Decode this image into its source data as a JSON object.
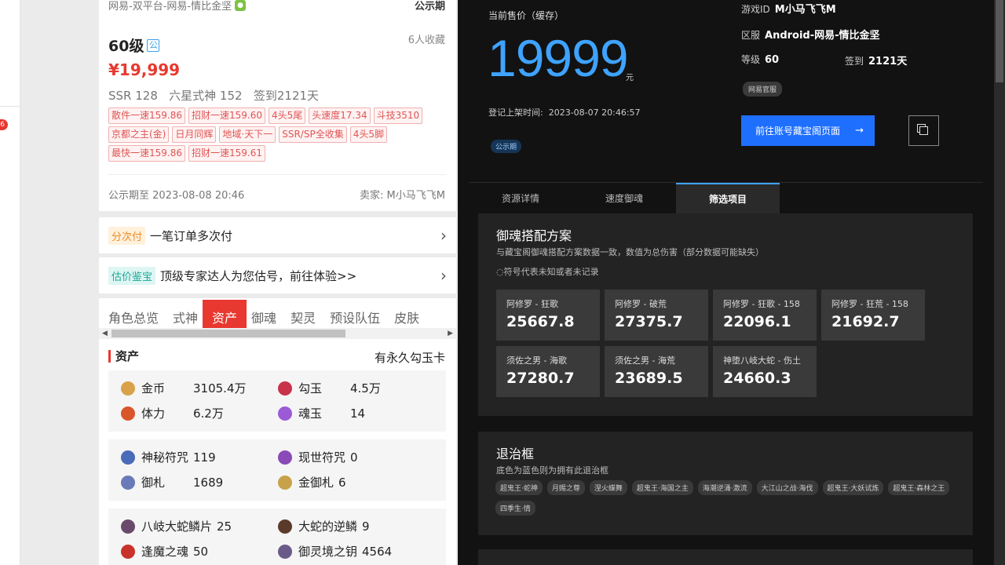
{
  "left": {
    "source": "网易-双平台-网易-情比金坚",
    "stage": "公示期",
    "level": "60级",
    "gong": "公",
    "favorites": "6人收藏",
    "price": "¥19,999",
    "stats": "SSR 128   六星式神 152   签到2121天",
    "tags": [
      "散件一速159.86",
      "招财一速159.60",
      "4头5尾",
      "头速度17.34",
      "斗技3510",
      "京都之主(金)",
      "日月同辉",
      "地域·天下一",
      "SSR/SP全收集",
      "4头5脚",
      "最快一速159.86",
      "招财一速159.61"
    ],
    "pubdate": "公示期至 2023-08-08 20:46",
    "seller": "卖家: M小马飞飞M",
    "promo1": {
      "badge": "分次付",
      "text": "一笔订单多次付"
    },
    "promo2": {
      "badge": "估价鉴宝",
      "text": "顶级专家达人为您估号，前往体验>>"
    },
    "tabs": [
      "角色总览",
      "式神",
      "资产",
      "御魂",
      "契灵",
      "预设队伍",
      "皮肤"
    ],
    "assets_title": "资产",
    "assets_right": "有永久勾玉卡",
    "assets_box1": [
      {
        "name": "金币",
        "value": "3105.4万",
        "color": "#d9a24a"
      },
      {
        "name": "勾玉",
        "value": "4.5万",
        "color": "#c8324a"
      },
      {
        "name": "体力",
        "value": "6.2万",
        "color": "#d9562a"
      },
      {
        "name": "魂玉",
        "value": "14",
        "color": "#9b5bd6"
      }
    ],
    "assets_box2": [
      {
        "name": "神秘符咒",
        "value": "119",
        "color": "#4a6bb8"
      },
      {
        "name": "现世符咒",
        "value": "0",
        "color": "#8a4ab8"
      },
      {
        "name": "御札",
        "value": "1689",
        "color": "#6a7ab8"
      },
      {
        "name": "金御札",
        "value": "6",
        "color": "#c8a24a"
      }
    ],
    "assets_box3": [
      {
        "name": "八岐大蛇鳞片",
        "value": "25",
        "color": "#6a4a6a"
      },
      {
        "name": "大蛇的逆鳞",
        "value": "9",
        "color": "#5a3a2a"
      },
      {
        "name": "逢魔之魂",
        "value": "50",
        "color": "#c8322a"
      },
      {
        "name": "御灵境之钥",
        "value": "4564",
        "color": "#6a5a8a"
      }
    ]
  },
  "right": {
    "price_label": "当前售价（缓存）",
    "price": "19999",
    "yuan": "元",
    "list_time_label": "登记上架时间:",
    "list_time": "2023-08-07 20:46:57",
    "stage_pill": "公示期",
    "game_id_label": "游戏ID",
    "game_id": "M小马飞飞M",
    "server_label": "区服",
    "server": "Android-网易-情比金坚",
    "level_label": "等级",
    "level": "60",
    "signin_label": "签到",
    "signin": "2121天",
    "official_pill": "网易官服",
    "go_button": "前往账号藏宝阁页面",
    "tabs": [
      "资源详情",
      "速度御魂",
      "筛选项目"
    ],
    "sec1": {
      "title": "御魂搭配方案",
      "desc": "与藏宝阁御魂搭配方案数据一致，数值为总伤害（部分数据可能缺失）",
      "note": "◌符号代表未知或者未记录",
      "cards": [
        {
          "label": "阿修罗 - 狂歌",
          "value": "25667.8"
        },
        {
          "label": "阿修罗 - 破荒",
          "value": "27375.7"
        },
        {
          "label": "阿修罗 - 狂歌 - 158",
          "value": "22096.1"
        },
        {
          "label": "阿修罗 - 狂荒 - 158",
          "value": "21692.7"
        },
        {
          "label": "须佐之男 - 海歌",
          "value": "27280.7"
        },
        {
          "label": "须佐之男 - 海荒",
          "value": "23689.5"
        },
        {
          "label": "神堕八岐大蛇 - 伤土",
          "value": "24660.3"
        }
      ]
    },
    "sec2": {
      "title": "退治框",
      "desc": "底色为蓝色则为拥有此退治框",
      "tags": [
        "超鬼王·蛇神",
        "月赐之尊",
        "涅火蝶舞",
        "超鬼王·海国之主",
        "海潮逆涌·激流",
        "大江山之战·海伐",
        "超鬼王·大妖试炼",
        "超鬼王·森林之王",
        "四季生·情"
      ]
    }
  }
}
